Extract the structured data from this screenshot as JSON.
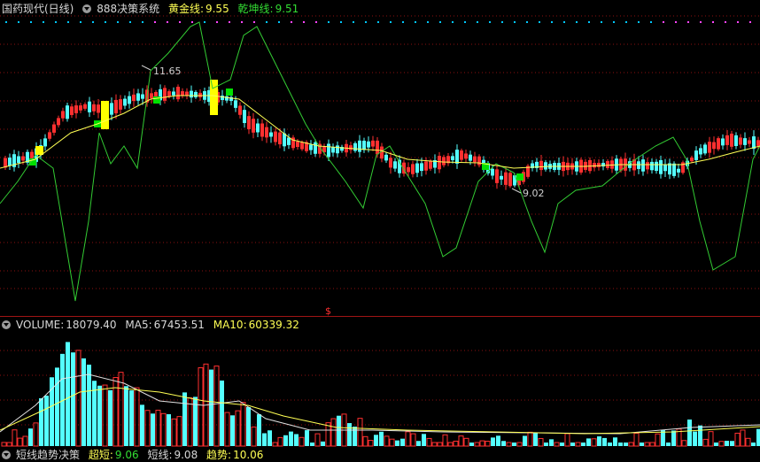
{
  "main_header": {
    "title": "国药现代(日线)",
    "indicator": "888决策系统",
    "gold_label": "黄金线:",
    "gold_value": "9.55",
    "qiankun_label": "乾坤线:",
    "qiankun_value": "9.51"
  },
  "annotations": {
    "high": "11.65",
    "low": "9.02",
    "marker": "$"
  },
  "volume_header": {
    "volume_label": "VOLUME:",
    "volume_value": "18079.40",
    "ma5_label": "MA5:",
    "ma5_value": "67453.51",
    "ma10_label": "MA10:",
    "ma10_value": "60339.32"
  },
  "bottom_header": {
    "name": "短线趋势决策",
    "a_label": "超短:",
    "a_value": "9.06",
    "b_label": "短线:",
    "b_value": "9.08",
    "c_label": "趋势:",
    "c_value": "10.06"
  },
  "colors": {
    "up": "#ff3030",
    "down": "#54ffff",
    "gold_line": "#ffff54",
    "green_line": "#33cc33",
    "grid": "#8b1010",
    "dot_cyan": "#00c8ff",
    "dot_magenta": "#ff44ff",
    "highlight_yellow": "#ffff00",
    "highlight_green": "#00e000"
  }
}
